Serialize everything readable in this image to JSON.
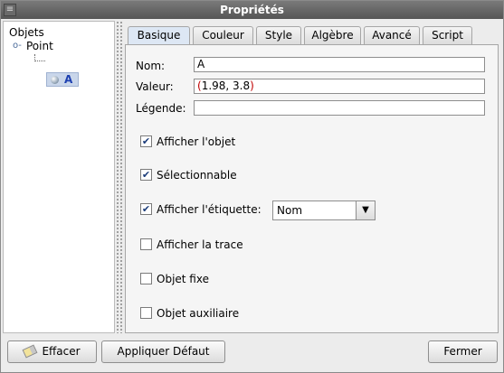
{
  "window": {
    "title": "Propriétés",
    "system_menu_icon": "menu-icon"
  },
  "tree": {
    "root_label": "Objets",
    "group_label": "Point",
    "item_label": "A"
  },
  "tabs": [
    "Basique",
    "Couleur",
    "Style",
    "Algèbre",
    "Avancé",
    "Script"
  ],
  "active_tab": "Basique",
  "fields": {
    "name_label": "Nom:",
    "name_value": "A",
    "value_label": "Valeur:",
    "value_open": "(",
    "value_text": "1.98, 3.8",
    "value_close": ")",
    "caption_label": "Légende:",
    "caption_value": ""
  },
  "checks": [
    {
      "label": "Afficher l'objet",
      "checked": true
    },
    {
      "label": "Sélectionnable",
      "checked": true
    },
    {
      "label": "Afficher l'étiquette:",
      "checked": true
    },
    {
      "label": "Afficher la trace",
      "checked": false
    },
    {
      "label": "Objet fixe",
      "checked": false
    },
    {
      "label": "Objet auxiliaire",
      "checked": false
    }
  ],
  "label_combo": {
    "selected": "Nom"
  },
  "buttons": {
    "clear": "Effacer",
    "apply_default": "Appliquer Défaut",
    "close": "Fermer"
  }
}
